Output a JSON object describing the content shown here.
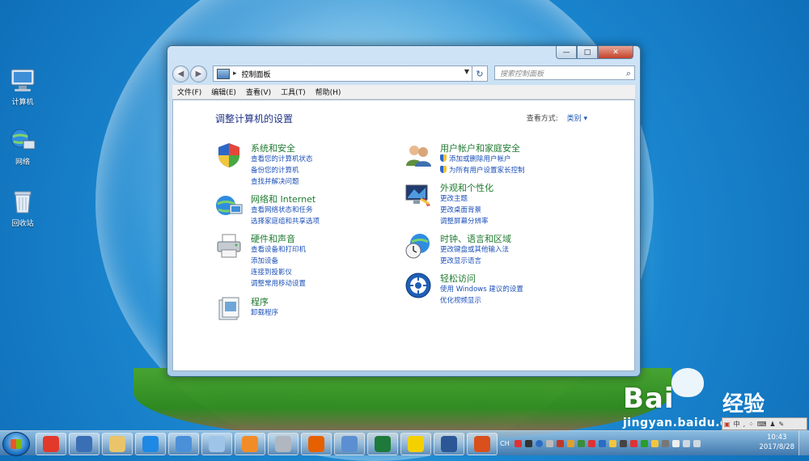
{
  "desktop": {
    "icons": [
      {
        "label": "计算机",
        "icon": "computer-icon"
      },
      {
        "label": "网络",
        "icon": "network-icon"
      },
      {
        "label": "回收站",
        "icon": "recycle-bin-icon"
      }
    ],
    "watermark": {
      "brand": "Bai",
      "brand_cn": "经验",
      "site": "jingyan.baidu.com"
    }
  },
  "window": {
    "controls": {
      "minimize": "—",
      "maximize": "□",
      "close": "✕"
    },
    "address": {
      "crumb": "控制面板",
      "refresh": "↻"
    },
    "search_placeholder": "搜索控制面板",
    "menu": [
      "文件(F)",
      "编辑(E)",
      "查看(V)",
      "工具(T)",
      "帮助(H)"
    ],
    "page_title": "调整计算机的设置",
    "view_by_label": "查看方式:",
    "view_by_value": "类别 ▾",
    "categories": [
      {
        "title": "系统和安全",
        "icon": "shield-icon",
        "links": [
          "查看您的计算机状态",
          "备份您的计算机",
          "查找并解决问题"
        ]
      },
      {
        "title": "网络和 Internet",
        "icon": "network-globe-icon",
        "links": [
          "查看网络状态和任务",
          "选择家庭组和共享选项"
        ]
      },
      {
        "title": "硬件和声音",
        "icon": "printer-icon",
        "links": [
          "查看设备和打印机",
          "添加设备",
          "连接到投影仪",
          "调整常用移动设置"
        ]
      },
      {
        "title": "程序",
        "icon": "programs-icon",
        "links": [
          "卸载程序"
        ]
      },
      {
        "title": "用户帐户和家庭安全",
        "icon": "users-icon",
        "links": [
          "添加或删除用户帐户",
          "为所有用户设置家长控制"
        ]
      },
      {
        "title": "外观和个性化",
        "icon": "display-icon",
        "links": [
          "更改主题",
          "更改桌面背景",
          "调整屏幕分辨率"
        ]
      },
      {
        "title": "时钟、语言和区域",
        "icon": "clock-globe-icon",
        "links": [
          "更改键盘或其他输入法",
          "更改显示语言"
        ]
      },
      {
        "title": "轻松访问",
        "icon": "ease-of-access-icon",
        "links": [
          "使用 Windows 建议的设置",
          "优化视频显示"
        ]
      }
    ]
  },
  "taskbar": {
    "apps": [
      {
        "name": "app-icon-1",
        "color": "#e23a2a"
      },
      {
        "name": "app-icon-2",
        "color": "#3a6fb5"
      },
      {
        "name": "explorer-icon",
        "color": "#e9c46a"
      },
      {
        "name": "ie-icon",
        "color": "#1e88e5"
      },
      {
        "name": "app-icon-5",
        "color": "#4a90d9"
      },
      {
        "name": "app-icon-6",
        "color": "#9ec4e8"
      },
      {
        "name": "app-icon-7",
        "color": "#f28c28"
      },
      {
        "name": "calculator-icon",
        "color": "#b0b7c0"
      },
      {
        "name": "firefox-icon",
        "color": "#e66000"
      },
      {
        "name": "control-panel-icon",
        "color": "#5b8fd1"
      },
      {
        "name": "excel-icon",
        "color": "#1d7a3a"
      },
      {
        "name": "app-icon-12",
        "color": "#f5d000"
      },
      {
        "name": "word-icon",
        "color": "#2b5797"
      },
      {
        "name": "matlab-icon",
        "color": "#d9501c"
      }
    ],
    "lang": "CH",
    "clock": {
      "time": "10:43",
      "date": "2017/8/28"
    },
    "ime": {
      "label": "中"
    }
  }
}
